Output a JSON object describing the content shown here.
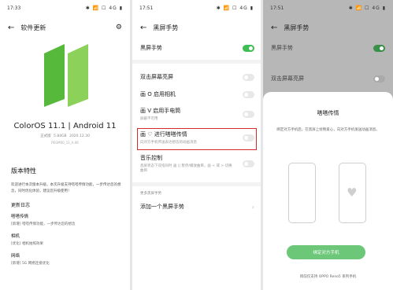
{
  "panel1": {
    "status": {
      "time": "17:33",
      "icons": "✱ 📶 ☐ 4G ▮"
    },
    "title": "软件更新",
    "os_version": "ColorOS 11.1 | Android 11",
    "meta": "正式版  5.84GB  2020.12.30",
    "build": "PEGM00_11_A.06",
    "features_heading": "版本特性",
    "intro": "欢迎进行本次版本升级，本次升级支持嗒嗒传情功能，一步传达您的想念，同时优化体验，建议您升级使用！",
    "sub_heading": "更新日志",
    "items": [
      {
        "title": "嗒嗒传情",
        "desc": "[新增] 嗒嗒传情功能，一步传达您的想念"
      },
      {
        "title": "相机",
        "desc": "[优化] 相机拍照效果"
      },
      {
        "title": "网络",
        "desc": "[新增] 5G 网络连接优化"
      }
    ]
  },
  "panel2": {
    "status": {
      "time": "17:51",
      "icons": "✱ 📶 ☐ 4G ▮"
    },
    "title": "黑屏手势",
    "rows": [
      {
        "label": "黑屏手势",
        "sub": ""
      },
      {
        "label": "双击屏幕亮屏",
        "sub": ""
      },
      {
        "label": "画 O 启用相机",
        "sub": ""
      },
      {
        "label": "画 V 启用手电筒",
        "sub": "屏蔽不可用"
      },
      {
        "label": "画 ♡ 进行嗒嗒传情",
        "sub": "向对方手机传送表达想念的动画消息"
      },
      {
        "label": "音乐控制",
        "sub": "息屏状态下双指同时 画 || 暂停/播放曲目，画 < 或 > 切换曲目"
      }
    ],
    "section_label": "更多黑屏手势",
    "add_label": "添加一个黑屏手势"
  },
  "panel3": {
    "status": {
      "time": "17:51",
      "icons": "✱ 📶 ☐ 4G ▮"
    },
    "title": "黑屏手势",
    "rows": [
      {
        "label": "黑屏手势"
      },
      {
        "label": "双击屏幕亮屏"
      }
    ],
    "sheet_title": "嗒嗒传情",
    "sheet_desc": "绑定对方手机后，在黑屏上绘制爱心，向对方手机发送动画消息。",
    "bind_button": "绑定对方手机",
    "support_text": "目前仅支持 OPPO Reno5 系列手机"
  },
  "colors": {
    "toggle_on": "#3fbe55",
    "highlight": "#d62a2a",
    "logo_green": "#57b93b",
    "button_green": "#6cc779"
  }
}
